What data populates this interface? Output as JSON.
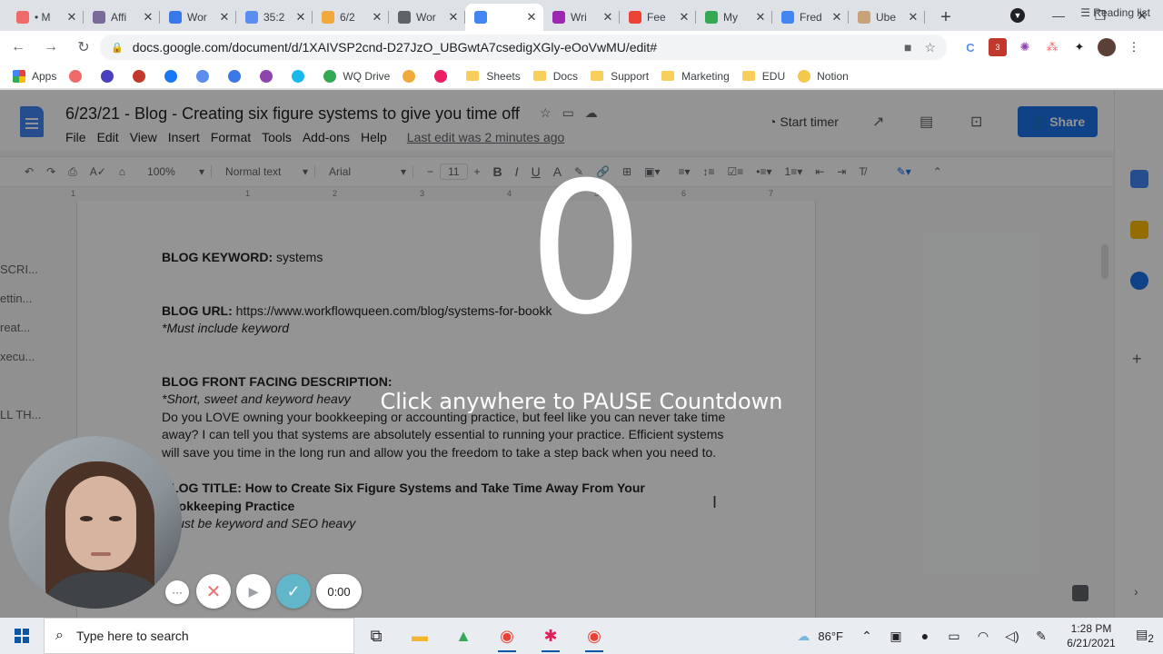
{
  "browser": {
    "tabs": [
      {
        "label": "• M",
        "color": "#f06a6a"
      },
      {
        "label": "Affi",
        "color": "#7a6a9a"
      },
      {
        "label": "Wor",
        "color": "#3b78e7"
      },
      {
        "label": "35:2",
        "color": "#5b8def"
      },
      {
        "label": "6/2",
        "color": "#f2a93b"
      },
      {
        "label": "Wor",
        "color": "#5f6368"
      },
      {
        "label": "",
        "color": "#4285f4",
        "active": true
      },
      {
        "label": "Wri",
        "color": "#9c27b0"
      },
      {
        "label": "Fee",
        "color": "#ea4335"
      },
      {
        "label": "My",
        "color": "#34a853"
      },
      {
        "label": "Fred",
        "color": "#4285f4"
      },
      {
        "label": "Ube",
        "color": "#c9a27a"
      }
    ],
    "url": "docs.google.com/document/d/1XAIVSP2cnd-D27JzO_UBGwtA7csedigXGly-eOoVwMU/edit#",
    "ext_badge": "3",
    "bookmarks": [
      {
        "label": "Apps",
        "type": "apps"
      },
      {
        "label": "",
        "type": "icon",
        "color": "#f06a6a"
      },
      {
        "label": "",
        "type": "icon",
        "color": "#4a3fbf"
      },
      {
        "label": "",
        "type": "icon",
        "color": "#c0392b"
      },
      {
        "label": "",
        "type": "icon",
        "color": "#1877f2"
      },
      {
        "label": "",
        "type": "icon",
        "color": "#5b8def"
      },
      {
        "label": "",
        "type": "icon",
        "color": "#3b78e7"
      },
      {
        "label": "",
        "type": "icon",
        "color": "#8e44ad"
      },
      {
        "label": "",
        "type": "icon",
        "color": "#1ab7ea"
      },
      {
        "label": "WQ Drive",
        "type": "icon",
        "color": "#34a853"
      },
      {
        "label": "",
        "type": "icon",
        "color": "#f2a93b"
      },
      {
        "label": "",
        "type": "icon",
        "color": "#e91e63"
      },
      {
        "label": "Sheets",
        "type": "folder"
      },
      {
        "label": "Docs",
        "type": "folder"
      },
      {
        "label": "Support",
        "type": "folder"
      },
      {
        "label": "Marketing",
        "type": "folder"
      },
      {
        "label": "EDU",
        "type": "folder"
      },
      {
        "label": "Notion",
        "type": "icon",
        "color": "#f2c94c"
      }
    ],
    "reading_list": "Reading list"
  },
  "docs": {
    "title": "6/23/21 - Blog - Creating six figure systems to give you time off",
    "menu": [
      "File",
      "Edit",
      "View",
      "Insert",
      "Format",
      "Tools",
      "Add-ons",
      "Help"
    ],
    "last_edit": "Last edit was 2 minutes ago",
    "start_timer": "Start timer",
    "share": "Share",
    "toolbar": {
      "zoom": "100%",
      "style": "Normal text",
      "font": "Arial",
      "size": "11"
    },
    "ruler": [
      "1",
      "1",
      "2",
      "3",
      "4",
      "5",
      "6",
      "7"
    ],
    "outline": [
      "SCRI...",
      "ettin...",
      "reat...",
      "xecu...",
      "",
      "LL TH..."
    ],
    "body": {
      "keyword_label": "BLOG KEYWORD:",
      "keyword_value": " systems",
      "url_label": "BLOG URL:",
      "url_value": " https://www.workflowqueen.com/blog/systems-for-bookk",
      "url_note": "*Must include keyword",
      "desc_label": "BLOG FRONT FACING DESCRIPTION:",
      "desc_note": "*Short, sweet and keyword heavy",
      "desc_text": "Do you LOVE owning your bookkeeping or accounting practice, but feel like you can never take time away? I can tell you that systems are absolutely essential to running your practice. Efficient systems will save you time in the long run and allow you the freedom to take a step back when you need to.",
      "title_label": "BLOG TITLE: How to Create Six Figure Systems and Take Time Away From Your Bookkeeping Practice",
      "title_note": "*Must be keyword and SEO heavy"
    }
  },
  "recorder": {
    "countdown": "0",
    "message": "Click anywhere to PAUSE Countdown",
    "more": "···",
    "cancel": "✕",
    "play": "▶",
    "done": "✓",
    "time": "0:00"
  },
  "taskbar": {
    "search_placeholder": "Type here to search",
    "weather": "86°F",
    "time": "1:28 PM",
    "date": "6/21/2021",
    "notifications": "2"
  }
}
